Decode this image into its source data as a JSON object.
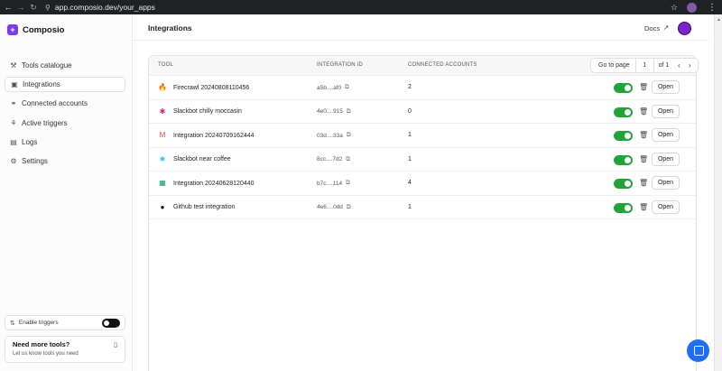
{
  "browser": {
    "url": "app.composio.dev/your_apps",
    "back_icon": "arrow-left-icon",
    "forward_icon": "arrow-right-icon",
    "reload_icon": "reload-icon"
  },
  "brand": {
    "name": "Composio",
    "logo_glyph": "+"
  },
  "sidebar": {
    "items": [
      {
        "label": "Tools catalogue",
        "icon": "tools-icon",
        "glyph": "⚒",
        "active": false
      },
      {
        "label": "Integrations",
        "icon": "integrations-icon",
        "glyph": "▣",
        "active": true
      },
      {
        "label": "Connected accounts",
        "icon": "link-icon",
        "glyph": "⚭",
        "active": false
      },
      {
        "label": "Active triggers",
        "icon": "trigger-icon",
        "glyph": "⚘",
        "active": false
      },
      {
        "label": "Logs",
        "icon": "logs-icon",
        "glyph": "▤",
        "active": false
      },
      {
        "label": "Settings",
        "icon": "gear-icon",
        "glyph": "⚙",
        "active": false
      }
    ],
    "enable_triggers_label": "Enable triggers",
    "enable_triggers_on": false,
    "more_tools_title": "Need more tools?",
    "more_tools_subtitle": "Let us know tools you need"
  },
  "header": {
    "title": "Integrations",
    "docs_label": "Docs"
  },
  "table": {
    "columns": {
      "tool": "TOOL",
      "integration_id": "INTEGRATION ID",
      "connected": "CONNECTED ACCOUNTS"
    },
    "pager": {
      "goto_label": "Go to page",
      "page": "1",
      "of_label": "of 1"
    },
    "open_label": "Open",
    "rows": [
      {
        "tool": "Firecrawl 20240808110456",
        "icon": "firecrawl-icon",
        "glyph": "🔥",
        "color": "#f97316",
        "id": "a5b....af0",
        "count": "2",
        "enabled": true
      },
      {
        "tool": "Slackbot chilly moccasin",
        "icon": "slack-icon",
        "glyph": "✱",
        "color": "#e01e5a",
        "id": "4e0....915",
        "count": "0",
        "enabled": true
      },
      {
        "tool": "Integration 20240709162444",
        "icon": "gmail-icon",
        "glyph": "M",
        "color": "#ea4335",
        "id": "03d....33a",
        "count": "1",
        "enabled": true
      },
      {
        "tool": "Slackbot near coffee",
        "icon": "slack-icon",
        "glyph": "✱",
        "color": "#36c5f0",
        "id": "8cc....7d2",
        "count": "1",
        "enabled": true
      },
      {
        "tool": "Integration 20240628120440",
        "icon": "google-sheets-icon",
        "glyph": "▦",
        "color": "#0f9d58",
        "id": "b7c....114",
        "count": "4",
        "enabled": true
      },
      {
        "tool": "Github test integration",
        "icon": "github-icon",
        "glyph": "●",
        "color": "#111111",
        "id": "4e6....0dd",
        "count": "1",
        "enabled": true
      }
    ]
  },
  "colors": {
    "accent": "#7c3aed",
    "toggle_on": "#22a33a",
    "chat": "#1e6ff1"
  }
}
